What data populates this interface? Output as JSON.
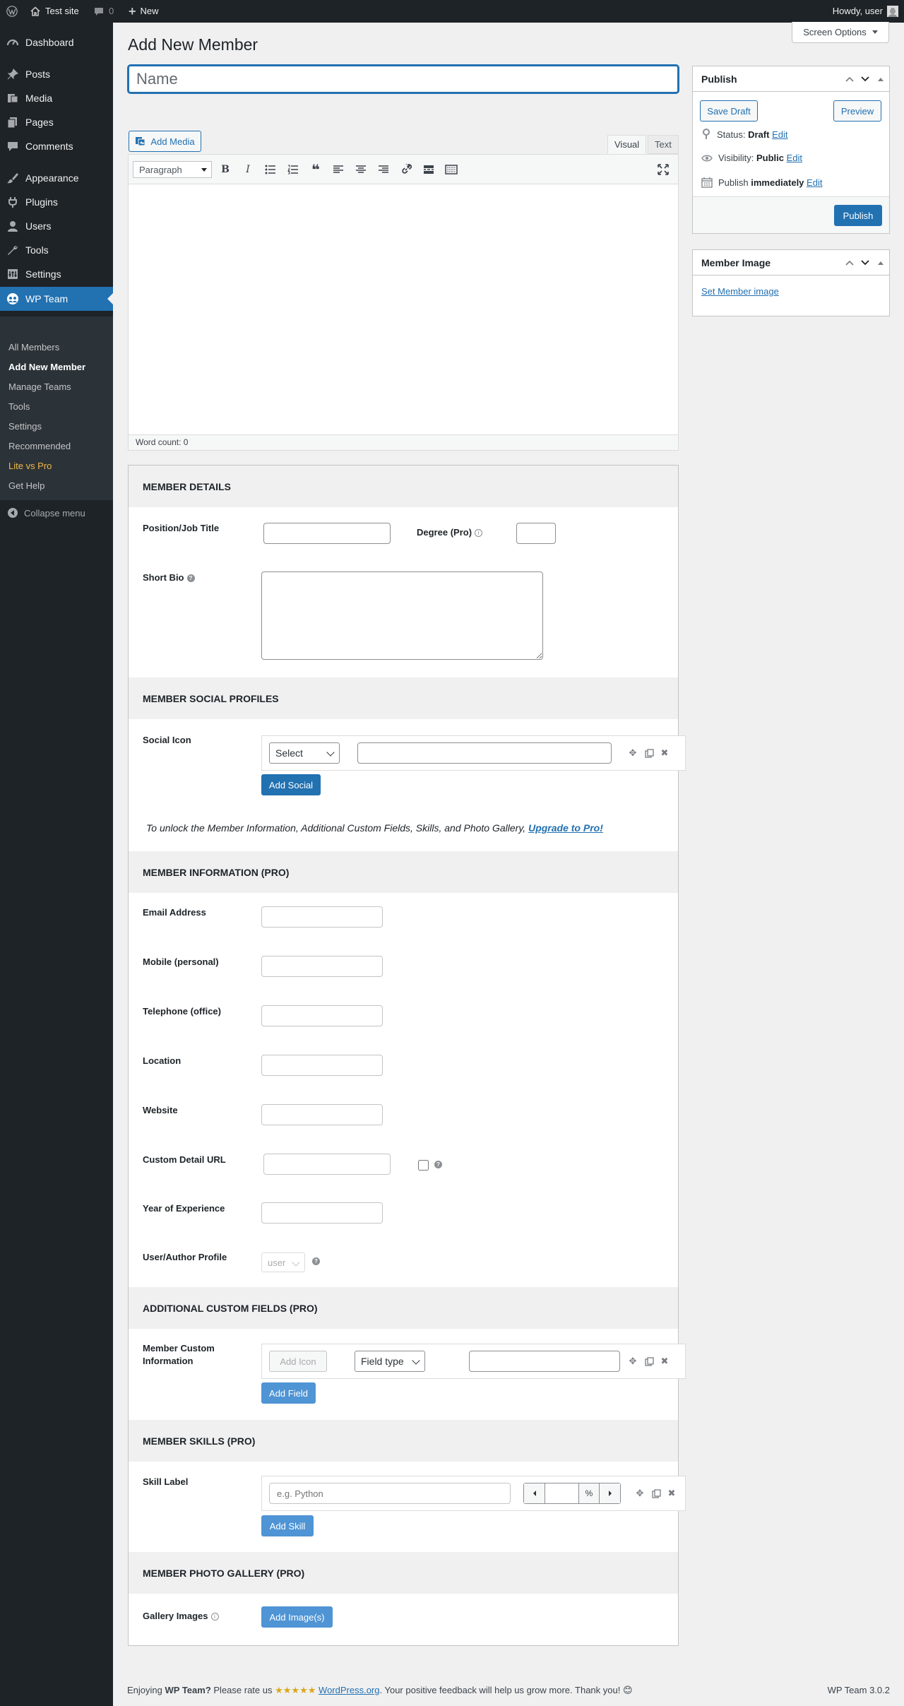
{
  "adminbar": {
    "site_name": "Test site",
    "comments_count": "0",
    "new_label": "New",
    "howdy": "Howdy, user"
  },
  "sidebar": {
    "items": [
      {
        "label": "Dashboard",
        "icon": "dashboard-icon"
      },
      {
        "label": "Posts",
        "icon": "pin-icon"
      },
      {
        "label": "Media",
        "icon": "media-icon"
      },
      {
        "label": "Pages",
        "icon": "pages-icon"
      },
      {
        "label": "Comments",
        "icon": "comment-icon"
      },
      {
        "label": "Appearance",
        "icon": "brush-icon"
      },
      {
        "label": "Plugins",
        "icon": "plugin-icon"
      },
      {
        "label": "Users",
        "icon": "user-icon"
      },
      {
        "label": "Tools",
        "icon": "wrench-icon"
      },
      {
        "label": "Settings",
        "icon": "settings-icon"
      },
      {
        "label": "WP Team",
        "icon": "team-icon"
      }
    ],
    "submenu": [
      "All Members",
      "Add New Member",
      "Manage Teams",
      "Tools",
      "Settings",
      "Recommended",
      "Lite vs Pro",
      "Get Help"
    ],
    "collapse_label": "Collapse menu"
  },
  "page": {
    "title": "Add New Member",
    "screen_options": "Screen Options",
    "name_placeholder": "Name"
  },
  "editor": {
    "add_media": "Add Media",
    "tab_visual": "Visual",
    "tab_text": "Text",
    "format": "Paragraph",
    "word_count": "Word count: 0"
  },
  "publish": {
    "title": "Publish",
    "save_draft": "Save Draft",
    "preview": "Preview",
    "status_label": "Status:",
    "status_value": "Draft",
    "visibility_label": "Visibility:",
    "visibility_value": "Public",
    "publish_label": "Publish",
    "publish_value": "immediately",
    "edit": "Edit",
    "publish_button": "Publish"
  },
  "member_image": {
    "title": "Member Image",
    "link": "Set Member image"
  },
  "details": {
    "heading": "MEMBER DETAILS",
    "position_label": "Position/Job Title",
    "degree_label": "Degree (Pro)",
    "short_bio_label": "Short Bio"
  },
  "social": {
    "heading": "MEMBER SOCIAL PROFILES",
    "icon_label": "Social Icon",
    "select_value": "Select",
    "add_button": "Add Social",
    "upgrade_text": "To unlock the Member Information, Additional Custom Fields, Skills, and Photo Gallery,",
    "upgrade_link": "Upgrade to Pro!"
  },
  "information": {
    "heading": "MEMBER INFORMATION (PRO)",
    "email": "Email Address",
    "mobile": "Mobile (personal)",
    "telephone": "Telephone (office)",
    "location": "Location",
    "website": "Website",
    "custom_url": "Custom Detail URL",
    "experience": "Year of Experience",
    "profile": "User/Author Profile",
    "profile_select": "user"
  },
  "custom_fields": {
    "heading": "ADDITIONAL CUSTOM FIELDS (PRO)",
    "label_line1": "Member Custom",
    "label_line2": "Information",
    "add_icon": "Add Icon",
    "field_type": "Field type",
    "add_field": "Add Field"
  },
  "skills": {
    "heading": "MEMBER SKILLS (PRO)",
    "label": "Skill Label",
    "placeholder": "e.g. Python",
    "percent": "%",
    "add_skill": "Add Skill"
  },
  "gallery": {
    "heading": "MEMBER PHOTO GALLERY (PRO)",
    "label": "Gallery Images",
    "add_images": "Add Image(s)"
  },
  "footer": {
    "text_1": "Enjoying",
    "plugin_name": "WP Team?",
    "text_2": "Please rate us",
    "stars": "★★★★★",
    "wporg": "WordPress.org",
    "text_3": ". Your positive feedback will help us grow more. Thank you! 😊",
    "version": "WP Team 3.0.2"
  },
  "colors": {
    "accent": "#2271b1",
    "adminbar": "#1d2327",
    "highlight": "#f0b849"
  }
}
